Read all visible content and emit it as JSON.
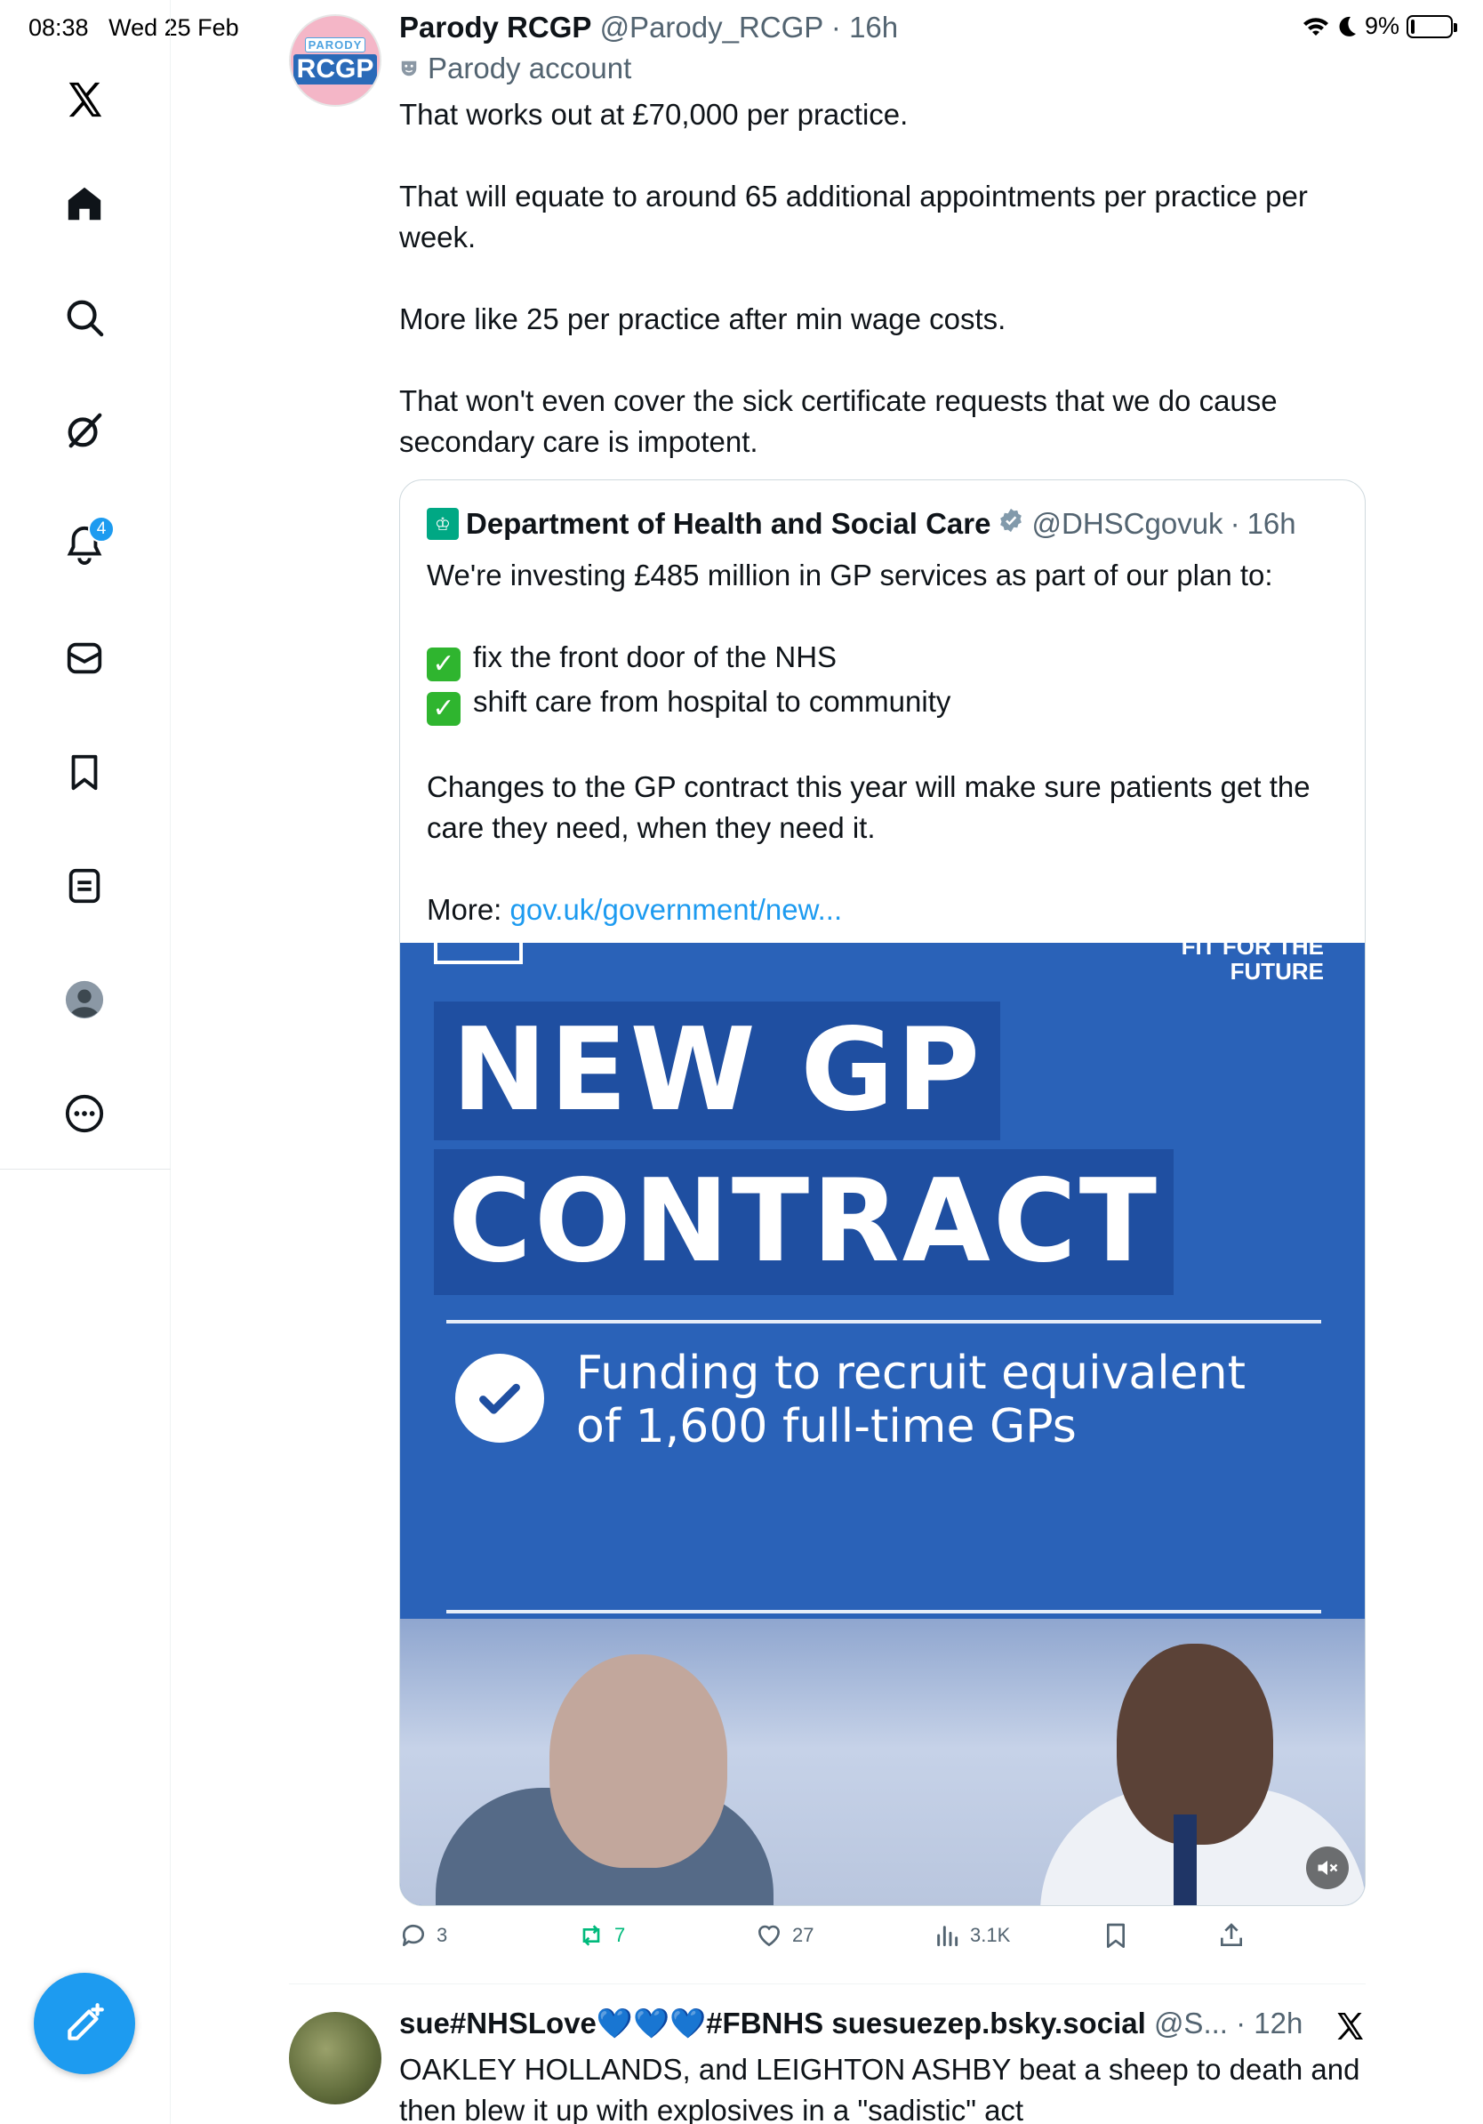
{
  "status_bar": {
    "time": "08:38",
    "date": "Wed 25 Feb",
    "battery": "9%",
    "battery_level": 0.09
  },
  "sidebar": {
    "notifications_badge": "4"
  },
  "tweet": {
    "author_name": "Parody RCGP",
    "author_handle": "@Parody_RCGP",
    "time": "16h",
    "parody_label": "Parody account",
    "avatar_top": "PARODY",
    "avatar_main": "RCGP",
    "paragraphs": [
      "That works out at £70,000 per practice.",
      "That will equate to around 65 additional appointments per practice per week.",
      "More like 25 per practice after min wage costs.",
      "That won't even cover the sick certificate requests that we do cause secondary care is impotent."
    ],
    "stats": {
      "replies": "3",
      "reposts": "7",
      "likes": "27",
      "views": "3.1K"
    }
  },
  "quote": {
    "author_name": "Department of Health and Social Care",
    "author_handle": "@DHSCgovuk",
    "time": "16h",
    "intro": "We're investing £485 million in GP services as part of our plan to:",
    "checks": [
      "fix the front door of the NHS",
      "shift care from hospital to community"
    ],
    "body": "Changes to the GP contract this year will make sure patients get the care they need, when they need it.",
    "more_label": "More:",
    "link": "gov.uk/government/new...",
    "media": {
      "corner": "FIT FOR THE\nFUTURE",
      "headline_1": "NEW GP",
      "headline_2": "CONTRACT",
      "funding_line_1": "Funding to recruit equivalent",
      "funding_line_2": "of 1,600 full-time GPs"
    }
  },
  "tweet2": {
    "author_name": "sue#NHSLove💙💙💙#FBNHS suesuezep.bsky.social",
    "author_handle": "@S...",
    "time": "12h",
    "text": "OAKLEY HOLLANDS, and LEIGHTON ASHBY beat a sheep to death and then blew it up with explosives in a \"sadistic\" act"
  }
}
